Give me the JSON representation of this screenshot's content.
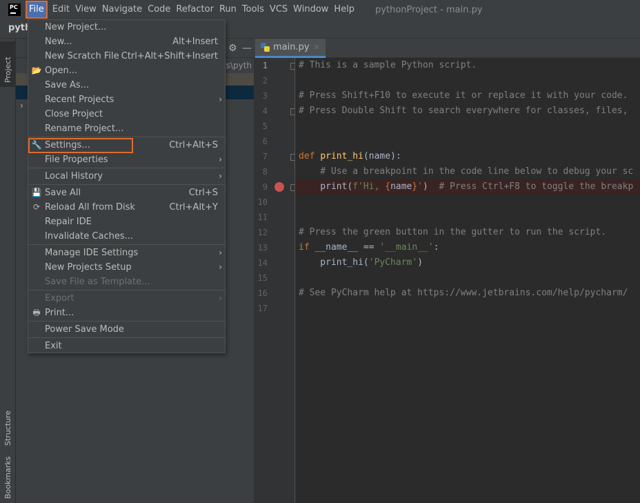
{
  "app": {
    "logo_text": "PC",
    "window_title": "pythonProject - main.py"
  },
  "menubar": {
    "items": [
      "File",
      "Edit",
      "View",
      "Navigate",
      "Code",
      "Refactor",
      "Run",
      "Tools",
      "VCS",
      "Window",
      "Help"
    ],
    "active": "File"
  },
  "navbar": {
    "project_crumb": "pyth"
  },
  "tool_windows": {
    "project_tab": "Project",
    "structure_tab": "Structure",
    "bookmarks_tab": "Bookmarks"
  },
  "project_panel": {
    "path_fragment": "ts\\pyth"
  },
  "file_menu": {
    "items": [
      {
        "label": "New Project...",
        "shortcut": "",
        "submenu": false
      },
      {
        "label": "New...",
        "shortcut": "Alt+Insert",
        "submenu": false
      },
      {
        "label": "New Scratch File",
        "shortcut": "Ctrl+Alt+Shift+Insert",
        "submenu": false
      },
      {
        "label": "Open...",
        "shortcut": "",
        "submenu": false,
        "icon": "folder-open-icon"
      },
      {
        "label": "Save As...",
        "shortcut": "",
        "submenu": false
      },
      {
        "label": "Recent Projects",
        "shortcut": "",
        "submenu": true
      },
      {
        "label": "Close Project",
        "shortcut": "",
        "submenu": false
      },
      {
        "label": "Rename Project...",
        "shortcut": "",
        "submenu": false
      },
      {
        "label": "Settings...",
        "shortcut": "Ctrl+Alt+S",
        "submenu": false,
        "icon": "wrench-icon"
      },
      {
        "label": "File Properties",
        "shortcut": "",
        "submenu": true
      },
      {
        "label": "Local History",
        "shortcut": "",
        "submenu": true
      },
      {
        "label": "Save All",
        "shortcut": "Ctrl+S",
        "submenu": false,
        "icon": "save-icon"
      },
      {
        "label": "Reload All from Disk",
        "shortcut": "Ctrl+Alt+Y",
        "submenu": false,
        "icon": "reload-icon"
      },
      {
        "label": "Repair IDE",
        "shortcut": "",
        "submenu": false
      },
      {
        "label": "Invalidate Caches...",
        "shortcut": "",
        "submenu": false
      },
      {
        "label": "Manage IDE Settings",
        "shortcut": "",
        "submenu": true
      },
      {
        "label": "New Projects Setup",
        "shortcut": "",
        "submenu": true
      },
      {
        "label": "Save File as Template...",
        "shortcut": "",
        "submenu": false,
        "disabled": true
      },
      {
        "label": "Export",
        "shortcut": "",
        "submenu": true,
        "disabled": true
      },
      {
        "label": "Print...",
        "shortcut": "",
        "submenu": false,
        "icon": "printer-icon"
      },
      {
        "label": "Power Save Mode",
        "shortcut": "",
        "submenu": false
      },
      {
        "label": "Exit",
        "shortcut": "",
        "submenu": false
      }
    ]
  },
  "editor": {
    "tab_label": "main.py",
    "line_numbers": [
      "1",
      "2",
      "3",
      "4",
      "5",
      "6",
      "7",
      "8",
      "9",
      "10",
      "11",
      "12",
      "13",
      "14",
      "15",
      "16",
      "17"
    ],
    "lines": {
      "l1": "# This is a sample Python script.",
      "l3": "# Press Shift+F10 to execute it or replace it with your code.",
      "l4": "# Press Double Shift to search everywhere for classes, files,",
      "l7_kw": "def",
      "l7_fn": "print_hi",
      "l7_rest": "(name):",
      "l8": "    # Use a breakpoint in the code line below to debug your sc",
      "l9_a": "    print(",
      "l9_str1": "f'Hi, ",
      "l9_brace1": "{",
      "l9_name": "name",
      "l9_brace2": "}",
      "l9_str2": "'",
      "l9_b": ")  ",
      "l9_comment": "# Press Ctrl+F8 to toggle the breakp",
      "l12": "# Press the green button in the gutter to run the script.",
      "l13_kw": "if",
      "l13_mid": " __name__ == ",
      "l13_str": "'__main__'",
      "l13_end": ":",
      "l14_a": "    print_hi(",
      "l14_str": "'PyCharm'",
      "l14_b": ")",
      "l16": "# See PyCharm help at https://www.jetbrains.com/help/pycharm/"
    }
  }
}
